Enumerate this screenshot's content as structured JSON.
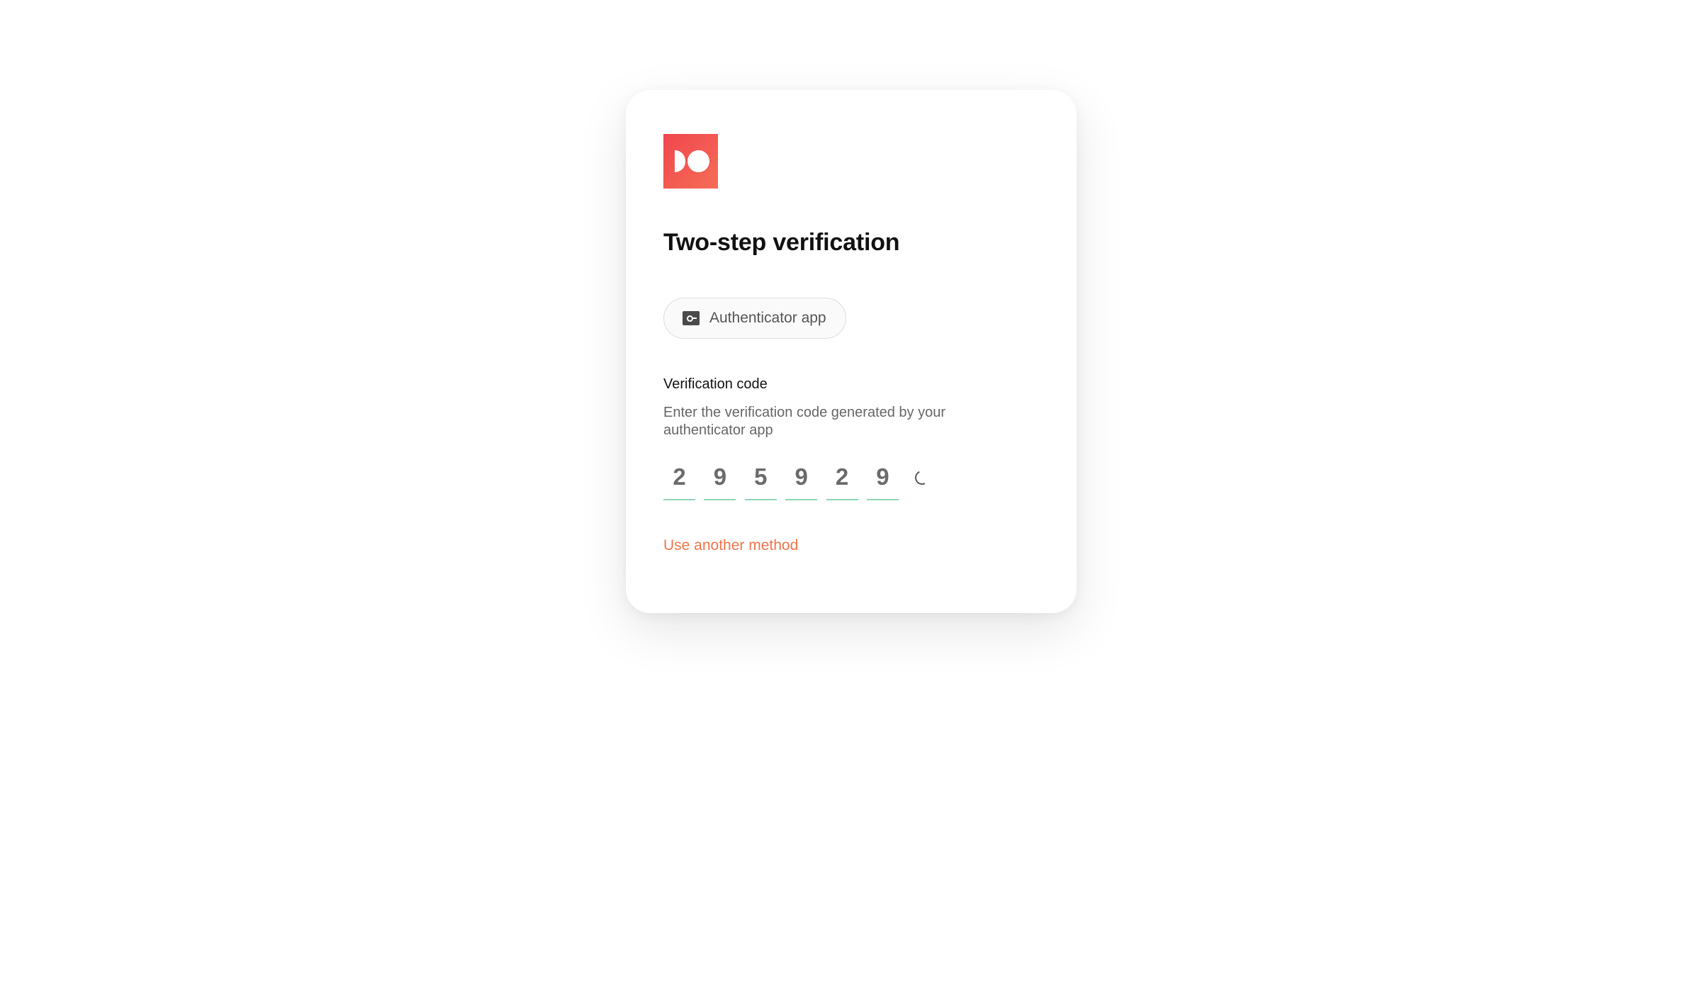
{
  "brand": {
    "logo_icon": "brand-logo-icon",
    "accent_color": "#f0464f",
    "link_color": "#f2734b",
    "code_underline_color": "#8fd6b4"
  },
  "page": {
    "title": "Two-step verification"
  },
  "method": {
    "icon": "authenticator-key-icon",
    "label": "Authenticator app"
  },
  "verification": {
    "label": "Verification code",
    "help": "Enter the verification code generated by your authenticator app",
    "digits": [
      "2",
      "9",
      "5",
      "9",
      "2",
      "9"
    ],
    "status_icon": "loading-spinner-icon"
  },
  "actions": {
    "other_method_label": "Use another method"
  }
}
